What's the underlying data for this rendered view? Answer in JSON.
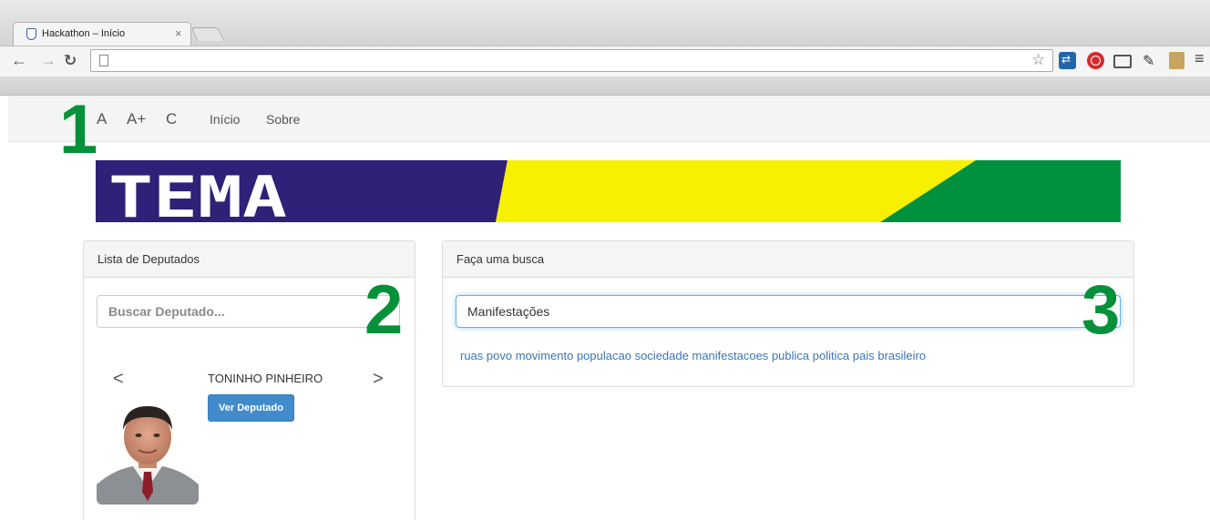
{
  "browser": {
    "tab_title": "Hackathon – Início",
    "tab_close": "×",
    "address": "",
    "colors": {
      "chrome_bg": "#e3e3e3",
      "toolbar_bg": "#f4f4f4"
    }
  },
  "navbar": {
    "items": [
      {
        "label": "A"
      },
      {
        "label": "A+"
      },
      {
        "label": "C"
      },
      {
        "label": "Início"
      },
      {
        "label": "Sobre"
      }
    ]
  },
  "annotations": {
    "n1": "1",
    "n2": "2",
    "n3": "3",
    "color": "#06903a"
  },
  "banner": {
    "logo_text": "TEMA",
    "colors": {
      "blue": "#2e2177",
      "yellow": "#f7f000",
      "green": "#00913f"
    }
  },
  "lista": {
    "title": "Lista de Deputados",
    "search_placeholder": "Buscar Deputado...",
    "prev": "<",
    "next": ">",
    "deputado_nome": "TONINHO PINHEIRO",
    "ver_button": "Ver Deputado"
  },
  "busca": {
    "title": "Faça uma busca",
    "query": "Manifestações",
    "tags": [
      "ruas",
      "povo",
      "movimento",
      "populacao",
      "sociedade",
      "manifestacoes",
      "publica",
      "politica",
      "pais",
      "brasileiro"
    ]
  }
}
